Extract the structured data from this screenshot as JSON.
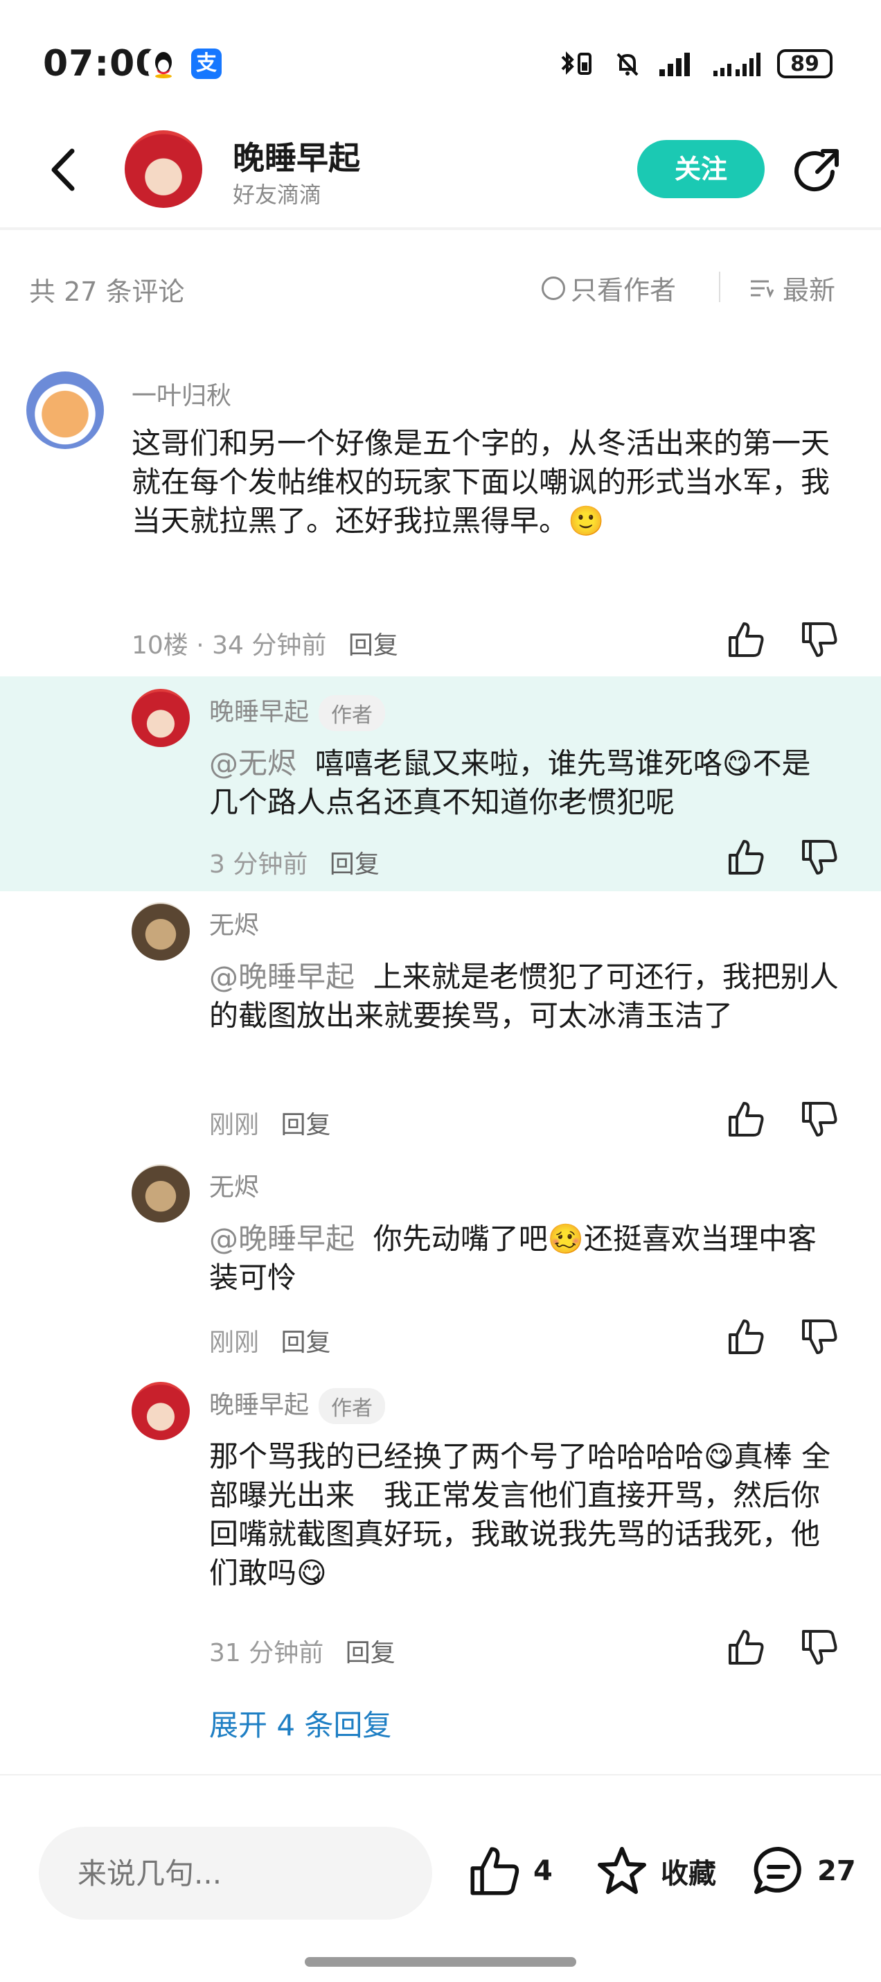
{
  "status": {
    "time": "07:00",
    "app_icons": [
      "qq-icon",
      "alipay-icon"
    ],
    "alipay_label": "支",
    "battery": "89"
  },
  "header": {
    "author_name": "晚睡早起",
    "author_subtitle": "好友滴滴",
    "follow_label": "关注"
  },
  "comment_bar": {
    "count_label": "共 27 条评论",
    "only_author_label": "只看作者",
    "sort_label": "最新"
  },
  "comments": [
    {
      "name": "一叶归秋",
      "text": "这哥们和另一个好像是五个字的，从冬活出来的第一天就在每个发帖维权的玩家下面以嘲讽的形式当水军，我当天就拉黑了。还好我拉黑得早。🙂",
      "meta": "10楼 · 34 分钟前",
      "reply_label": "回复"
    }
  ],
  "replies": [
    {
      "name": "晚睡早起",
      "badge": "作者",
      "mention": "@无烬",
      "text": "嘻嘻老鼠又来啦，谁先骂谁死咯😋不是几个路人点名还真不知道你老惯犯呢",
      "time": "3 分钟前",
      "reply_label": "回复"
    },
    {
      "name": "无烬",
      "mention": "@晚睡早起",
      "text": "上来就是老惯犯了可还行，我把别人的截图放出来就要挨骂，可太冰清玉洁了",
      "time": "刚刚",
      "reply_label": "回复"
    },
    {
      "name": "无烬",
      "mention": "@晚睡早起",
      "text": "你先动嘴了吧🥴还挺喜欢当理中客装可怜",
      "time": "刚刚",
      "reply_label": "回复"
    },
    {
      "name": "晚睡早起",
      "badge": "作者",
      "text": "那个骂我的已经换了两个号了哈哈哈哈😋真棒 全部曝光出来　我正常发言他们直接开骂，然后你回嘴就截图真好玩，我敢说我先骂的话我死，他们敢吗😋",
      "time": "31 分钟前",
      "reply_label": "回复"
    }
  ],
  "expand_label": "展开 4 条回复",
  "bottom_bar": {
    "input_placeholder": "来说几句...",
    "like_count": "4",
    "collect_label": "收藏",
    "comment_count": "27"
  },
  "colors": {
    "accent": "#1bc9b3",
    "highlight_bg": "#e7f7f4",
    "link": "#1f7fc4"
  }
}
